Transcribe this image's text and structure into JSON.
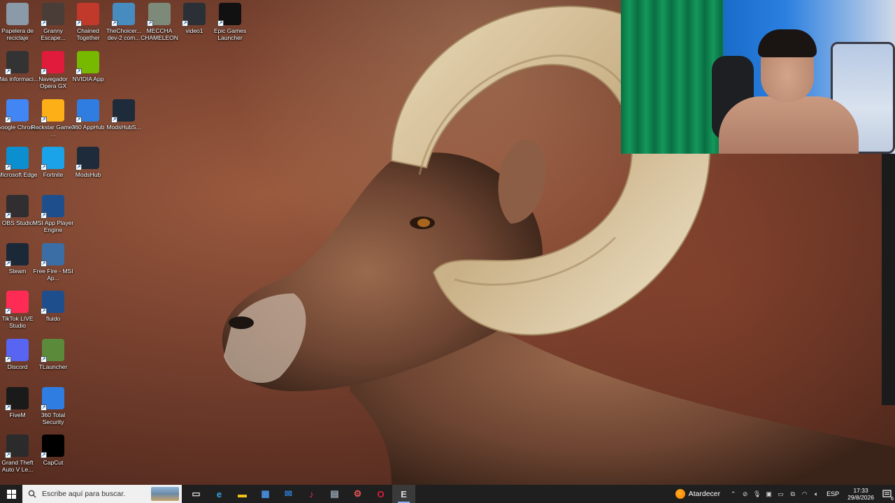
{
  "desktop_icons": [
    {
      "id": "recycle-bin",
      "label": "Papelera de reciclaje",
      "icon": "recycle-bin-icon",
      "color": "#8a9aa8"
    },
    {
      "id": "granny",
      "label": "Granny Escape...",
      "icon": "granny-game-icon",
      "color": "#4a3c36"
    },
    {
      "id": "chained-together",
      "label": "Chained Together",
      "icon": "chained-together-icon",
      "color": "#c0392b"
    },
    {
      "id": "thechoicer",
      "label": "TheChoicer... dev-2 com...",
      "icon": "godot-icon",
      "color": "#478cbf"
    },
    {
      "id": "meccha",
      "label": "MECCHA CHAMELEON",
      "icon": "meccha-icon",
      "color": "#7d8a7a"
    },
    {
      "id": "video1",
      "label": "video1",
      "icon": "video-file-icon",
      "color": "#2b2f36"
    },
    {
      "id": "epic",
      "label": "Epic Games Launcher",
      "icon": "epic-games-icon",
      "color": "#111111"
    },
    {
      "id": "mas-info",
      "label": "Más informaci...",
      "icon": "info-circle-icon",
      "color": "#333333"
    },
    {
      "id": "opera-gx",
      "label": "Navegador Opera GX",
      "icon": "opera-gx-icon",
      "color": "#e01b3c"
    },
    {
      "id": "nvidia",
      "label": "NVIDIA App",
      "icon": "nvidia-icon",
      "color": "#76b900"
    },
    {
      "id": "chrome",
      "label": "Google Chrome",
      "icon": "chrome-icon",
      "color": "#4285f4"
    },
    {
      "id": "rockstar",
      "label": "Rockstar Games ...",
      "icon": "rockstar-icon",
      "color": "#fcaf17"
    },
    {
      "id": "apphub",
      "label": "360 AppHub",
      "icon": "apphub-icon",
      "color": "#2f7de1"
    },
    {
      "id": "modshubs",
      "label": "ModsHubS...",
      "icon": "modshub-icon",
      "color": "#1d2b3a"
    },
    {
      "id": "edge",
      "label": "Microsoft Edge",
      "icon": "edge-icon",
      "color": "#0c8fd1"
    },
    {
      "id": "fortnite",
      "label": "Fortnite",
      "icon": "fortnite-icon",
      "color": "#1aa3e8"
    },
    {
      "id": "modshub",
      "label": "ModsHub",
      "icon": "modshub-icon",
      "color": "#1d2b3a"
    },
    {
      "id": "obs",
      "label": "OBS Studio",
      "icon": "obs-icon",
      "color": "#302e31"
    },
    {
      "id": "msi",
      "label": "MSI App Player Engine",
      "icon": "msi-app-player-icon",
      "color": "#1e4f8c"
    },
    {
      "id": "freefire",
      "label": "Free Fire - MSI Ap...",
      "icon": "free-fire-icon",
      "color": "#3b6ea5"
    },
    {
      "id": "steam",
      "label": "Steam",
      "icon": "steam-icon",
      "color": "#1b2838"
    },
    {
      "id": "tiktok",
      "label": "TikTok LIVE Studio",
      "icon": "tiktok-icon",
      "color": "#fe2c55"
    },
    {
      "id": "fluido",
      "label": "fluido",
      "icon": "msi-app-player-icon",
      "color": "#1e4f8c"
    },
    {
      "id": "discord",
      "label": "Discord",
      "icon": "discord-icon",
      "color": "#5865f2"
    },
    {
      "id": "tlauncher",
      "label": "TLauncher",
      "icon": "minecraft-block-icon",
      "color": "#5b8a3a"
    },
    {
      "id": "fivem",
      "label": "FiveM",
      "icon": "fivem-icon",
      "color": "#1a1a1a"
    },
    {
      "id": "360-security",
      "label": "360 Total Security",
      "icon": "360-security-icon",
      "color": "#2f7de1"
    },
    {
      "id": "gta",
      "label": "Grand Theft Auto V Le...",
      "icon": "gta-icon",
      "color": "#2b2b2b"
    },
    {
      "id": "capcut",
      "label": "CapCut",
      "icon": "capcut-icon",
      "color": "#000000"
    }
  ],
  "taskbar": {
    "search_placeholder": "Escribe aquí para buscar.",
    "pinned": [
      {
        "name": "task-view-icon",
        "glyph": "▭"
      },
      {
        "name": "edge-icon",
        "glyph": "e"
      },
      {
        "name": "file-explorer-icon",
        "glyph": "▬"
      },
      {
        "name": "store-icon",
        "glyph": "▦"
      },
      {
        "name": "mail-icon",
        "glyph": "✉"
      },
      {
        "name": "tiktok-icon",
        "glyph": "♪"
      },
      {
        "name": "notepad-icon",
        "glyph": "▤"
      },
      {
        "name": "chained-together-icon",
        "glyph": "⚙"
      },
      {
        "name": "opera-gx-icon",
        "glyph": "O"
      },
      {
        "name": "epic-games-icon",
        "glyph": "E"
      }
    ],
    "weather": "Atardecer",
    "language": "ESP",
    "time": "17:33",
    "date": "29/8/2026",
    "notification_count": "6"
  }
}
